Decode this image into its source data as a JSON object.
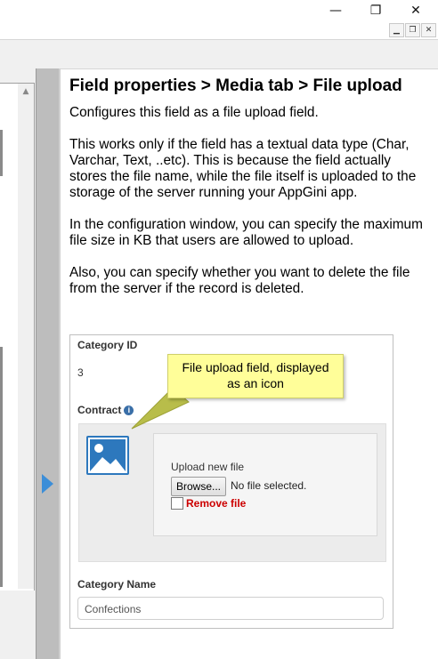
{
  "window": {
    "minimize_glyph": "—",
    "maximize_glyph": "❐",
    "close_glyph": "✕",
    "mdi_minimize_glyph": "▁",
    "mdi_restore_glyph": "❐",
    "mdi_close_glyph": "✕"
  },
  "left_pane": {
    "scroll_up_glyph": "▲"
  },
  "help": {
    "title": "Field properties > Media tab > File upload",
    "paragraphs": [
      "Configures this field as a file upload field.",
      "This works only if the field has a textual data type (Char, Varchar, Text, ..etc). This is because the field actually stores the file name, while the file itself is uploaded to the storage of the server running your AppGini app.",
      "In the configuration window, you can specify the maximum file size in KB that users are allowed to upload.",
      "Also, you can specify whether you want to delete the file from the server if the record is deleted."
    ]
  },
  "form": {
    "category_id_label": "Category ID",
    "category_id_value": "3",
    "contract_label": "Contract",
    "info_glyph": "i",
    "upload_new_file_label": "Upload new file",
    "browse_label": "Browse...",
    "no_file_text": "No file selected.",
    "remove_file_label": "Remove file",
    "category_name_label": "Category Name",
    "category_name_value": "Confections"
  },
  "callout": {
    "line1": "File upload field, displayed",
    "line2": "as an icon"
  },
  "colors": {
    "accent_blue": "#2d78bd",
    "remove_red": "#cc0000",
    "callout_yellow": "#fffe99",
    "callout_arrow": "#b8bd4a"
  }
}
